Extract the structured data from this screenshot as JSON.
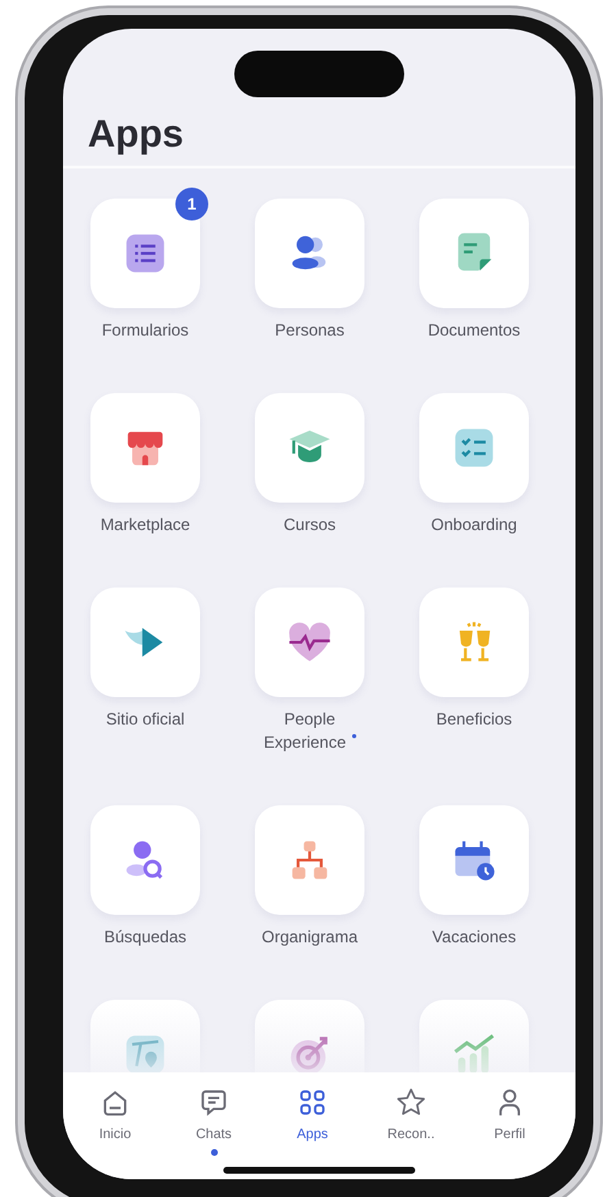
{
  "screen_title": "Apps",
  "apps": [
    {
      "kind": "app",
      "label": "Formularios",
      "badge": "1",
      "dot": false
    },
    {
      "kind": "app",
      "label": "Personas",
      "dot": false
    },
    {
      "kind": "app",
      "label": "Documentos",
      "dot": false
    },
    {
      "kind": "app",
      "label": "Marketplace",
      "dot": false
    },
    {
      "kind": "app",
      "label": "Cursos",
      "dot": false
    },
    {
      "kind": "app",
      "label": "Onboarding",
      "dot": false
    },
    {
      "kind": "app",
      "label": "Sitio oficial",
      "dot": false
    },
    {
      "kind": "app",
      "label": "People Experience",
      "dot": true
    },
    {
      "kind": "app",
      "label": "Beneficios",
      "dot": false
    },
    {
      "kind": "app",
      "label": "Búsquedas",
      "dot": false
    },
    {
      "kind": "app",
      "label": "Organigrama",
      "dot": false
    },
    {
      "kind": "app",
      "label": "Vacaciones",
      "dot": false
    },
    {
      "kind": "partial"
    },
    {
      "kind": "partial"
    },
    {
      "kind": "partial"
    }
  ],
  "nav": [
    {
      "label": "Inicio",
      "selected": false,
      "dot": false
    },
    {
      "label": "Chats",
      "selected": false,
      "dot": true
    },
    {
      "label": "Apps",
      "selected": true,
      "dot": false
    },
    {
      "label": "Recon..",
      "selected": false,
      "dot": false
    },
    {
      "label": "Perfil",
      "selected": false,
      "dot": false
    }
  ]
}
